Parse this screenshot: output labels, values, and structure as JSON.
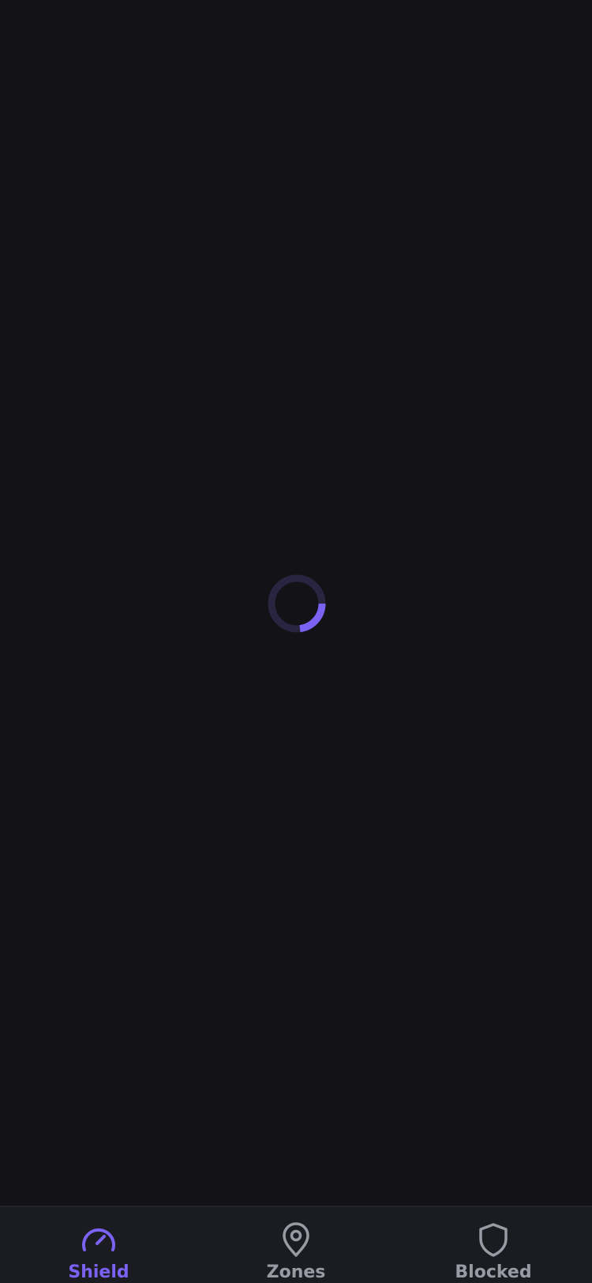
{
  "theme": {
    "background": "#121217",
    "tabbar_background": "#1b1c22",
    "accent": "#7b62f3",
    "inactive": "#9a9aa5",
    "spinner_track": "#29243f"
  },
  "loading": {
    "state": "loading",
    "indicator": "spinner"
  },
  "tabbar": {
    "active_tab": "Shield",
    "tabs": [
      {
        "label": "Shield",
        "icon": "gauge-icon",
        "active": true
      },
      {
        "label": "Zones",
        "icon": "map-pin-icon",
        "active": false
      },
      {
        "label": "Blocked",
        "icon": "shield-icon",
        "active": false
      }
    ]
  }
}
